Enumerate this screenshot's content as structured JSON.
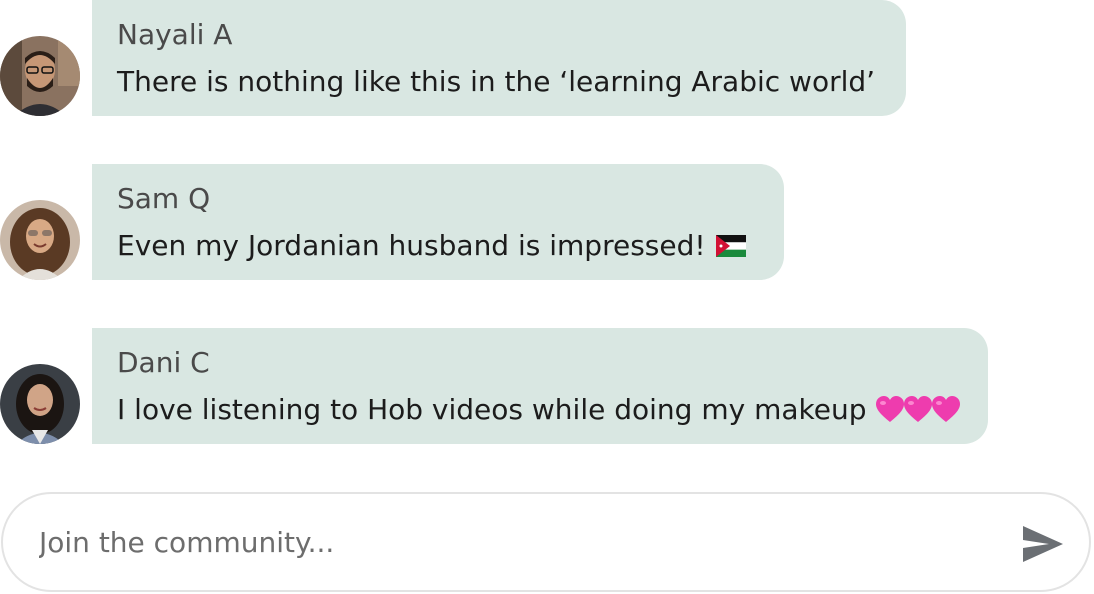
{
  "messages": [
    {
      "author": "Nayali A",
      "text": "There is nothing like this in the ‘learning Arabic world’",
      "avatar": "man-with-glasses-avatar"
    },
    {
      "author": "Sam Q",
      "text": "Even my Jordanian husband is impressed!",
      "emoji": "jordan-flag-emoji",
      "avatar": "curly-hair-woman-avatar"
    },
    {
      "author": "Dani C",
      "text": "I love listening to Hob videos while doing my makeup",
      "emoji": "three-pink-hearts-emoji",
      "avatar": "dark-hair-woman-avatar"
    }
  ],
  "composer": {
    "placeholder": "Join the community...",
    "send_icon": "send-icon"
  },
  "colors": {
    "bubble_bg": "#d9e7e2",
    "input_border": "#e3e3e3",
    "send_icon": "#6b6f74"
  }
}
